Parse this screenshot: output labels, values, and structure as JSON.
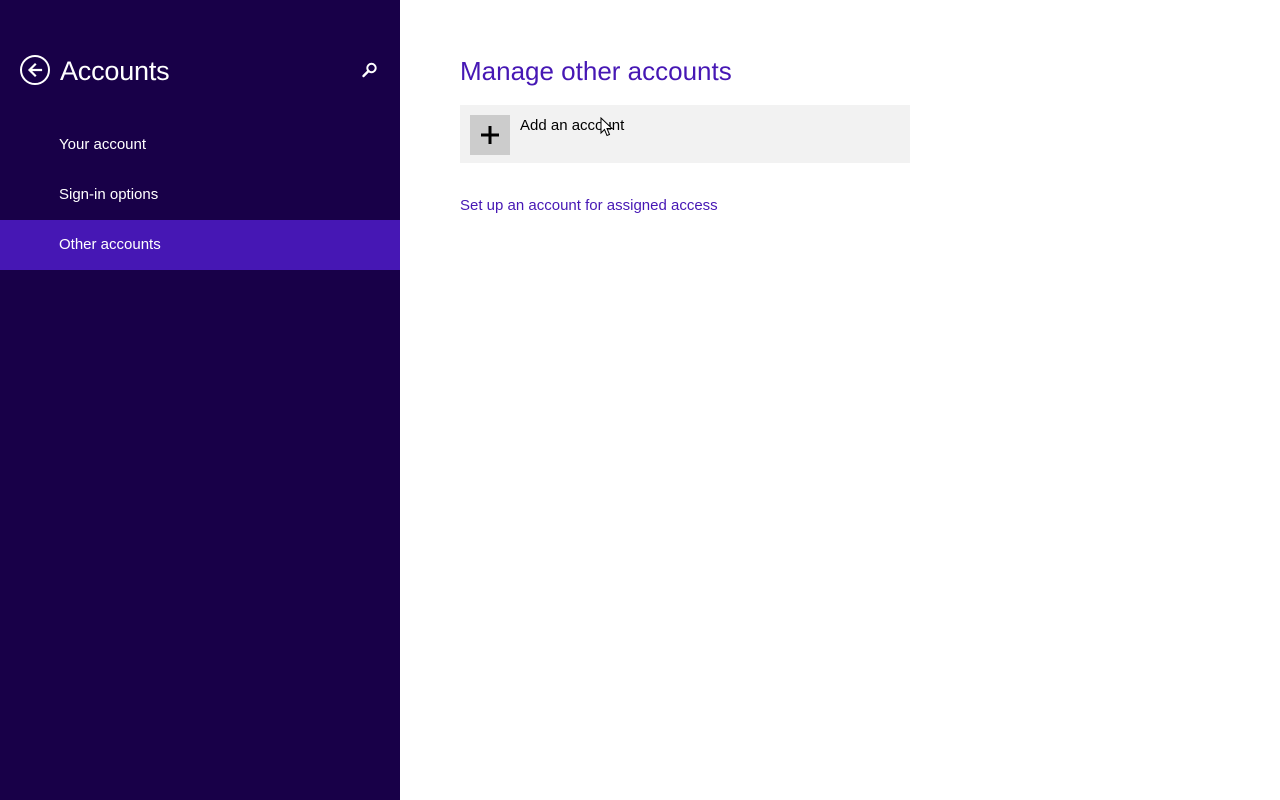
{
  "sidebar": {
    "title": "Accounts",
    "back_icon": "back-arrow-icon",
    "search_icon": "search-icon",
    "items": [
      {
        "label": "Your account",
        "selected": false
      },
      {
        "label": "Sign-in options",
        "selected": false
      },
      {
        "label": "Other accounts",
        "selected": true
      }
    ]
  },
  "main": {
    "title": "Manage other accounts",
    "add_account": {
      "label": "Add an account",
      "icon": "plus-icon"
    },
    "assigned_access_link": "Set up an account for assigned access"
  },
  "colors": {
    "sidebar_bg": "#180048",
    "accent": "#4617b4",
    "tile_bg": "#f2f2f2",
    "icon_bg": "#cccccc"
  }
}
